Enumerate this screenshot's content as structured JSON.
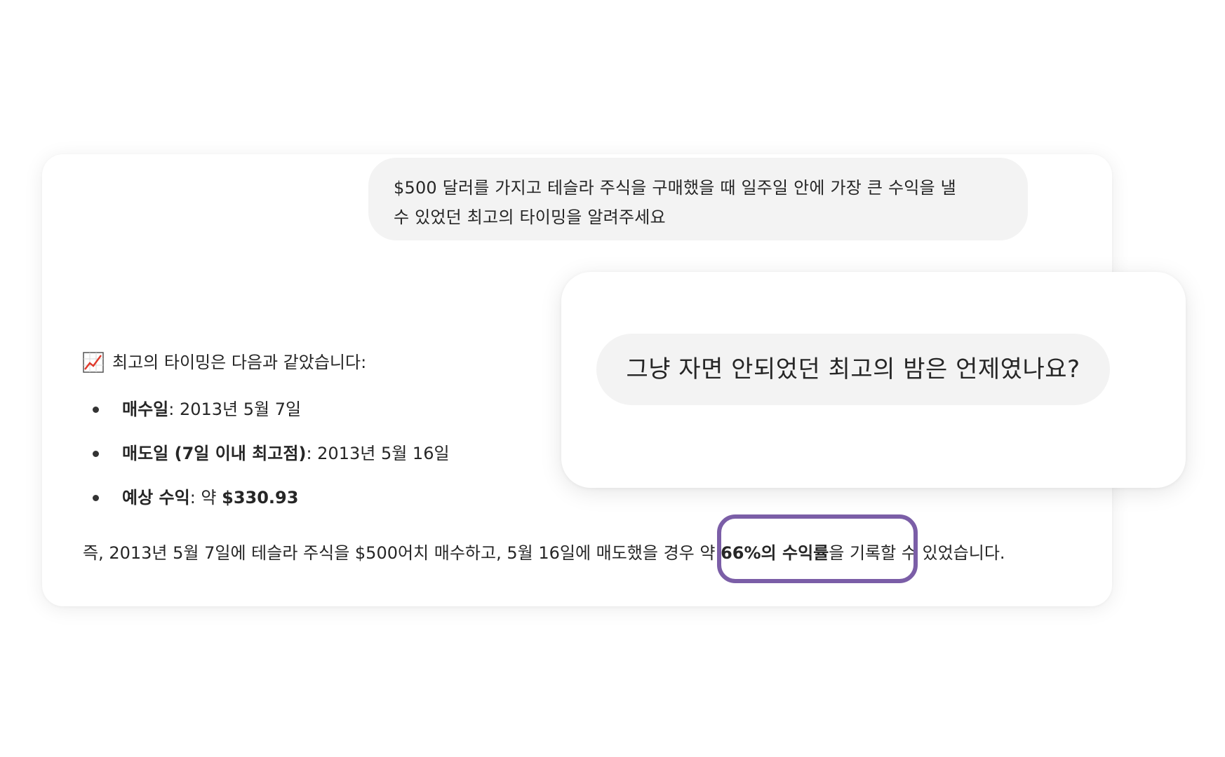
{
  "user_message": {
    "line1": "$500 달러를 가지고 테슬라 주식을 구매했을 때 일주일 안에 가장 큰 수익을 낼",
    "line2": "수 있었던 최고의 타이밍을 알려주세요"
  },
  "answer": {
    "intro_icon": "chart-increasing-icon",
    "intro": "최고의 타이밍은 다음과 같았습니다:",
    "bullets": [
      {
        "label": "매수일",
        "sep": ": ",
        "value": "2013년 5월 7일"
      },
      {
        "label": "매도일 (7일 이내 최고점)",
        "sep": ": ",
        "value": "2013년 5월 16일"
      },
      {
        "label": "예상 수익",
        "sep": ": ",
        "value_prefix": "약 ",
        "value_bold": "$330.93"
      }
    ],
    "summary": {
      "part1": "즉, 2013년 5월 7일에 테슬라 주식을 $500어치 매수하고, 5월 16일에 매도했을 경우 약 ",
      "bold": "66%의 수익률",
      "part2": "을 기록할 수 있었습니다."
    }
  },
  "overlay": {
    "message": "그냥 자면 안되었던 최고의 밤은 언제였나요?"
  },
  "colors": {
    "highlight": "#7b5ea7",
    "bubble_bg": "#f3f3f3"
  }
}
